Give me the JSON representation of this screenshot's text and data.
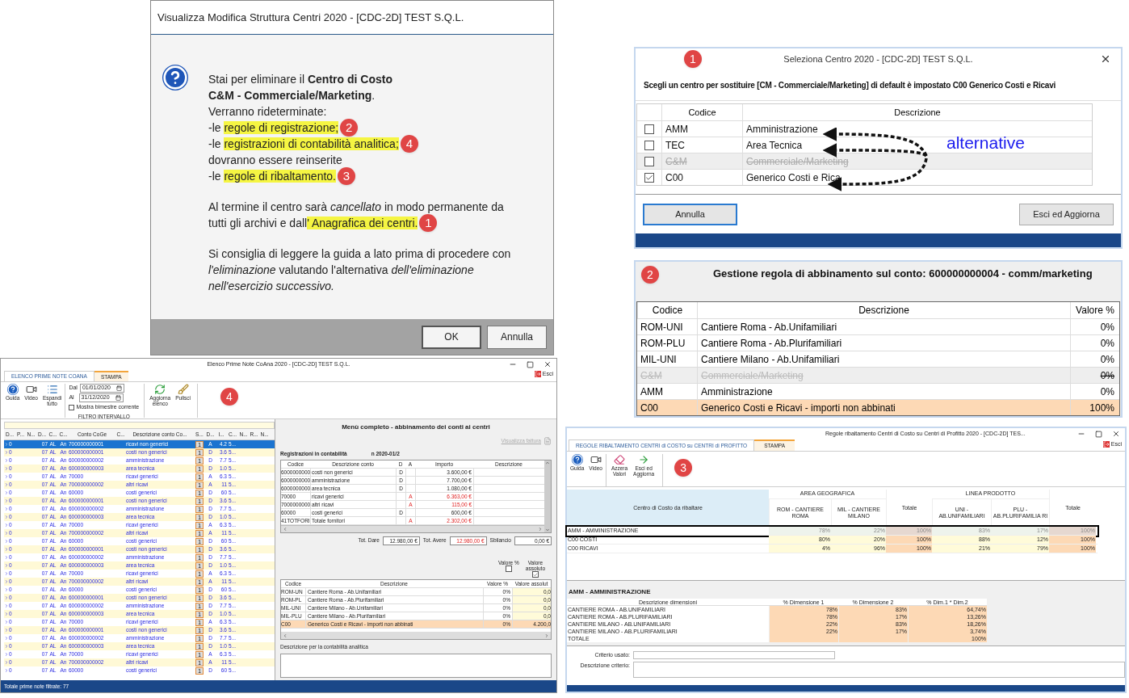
{
  "dialog": {
    "title": "Visualizza Modifica Struttura Centri 2020 - [CDC-2D] TEST S.Q.L.",
    "paragraphs": [
      [
        {
          "text": "Stai per eliminare il **Centro di Costo**"
        },
        {
          "text": "**C&M - Commerciale/Marketing**."
        },
        {
          "text": "Verranno rideterminate:"
        },
        {
          "text": "-le ",
          "highlight": "regole di registrazione;",
          "badge": "2"
        },
        {
          "text": "-le ",
          "highlight": "registrazioni di contabilità analitica;",
          "badge": "4"
        },
        {
          "text": "dovranno essere reinserite"
        },
        {
          "text": "-le ",
          "highlight": "regole di ribaltamento.",
          "badge": "3"
        }
      ],
      [
        {
          "text": "Al termine il centro sarà *cancellato* in modo permanente da"
        },
        {
          "text": "tutti gli archivi e dall",
          "highlight": "' Anagrafica dei centri.",
          "badge": "1"
        }
      ]
    ],
    "advice": "Si consiglia di leggere la guida a lato prima di procedere con\n*l'eliminazione* valutando l'alternativa *dell'eliminazione*\n*nell'esercizio successivo.*",
    "buttons": [
      {
        "label": "OK",
        "default": true
      },
      {
        "label": "Annulla",
        "default": false
      }
    ]
  },
  "select_window": {
    "badge": "1",
    "title": "Seleziona Centro 2020 - [CDC-2D] TEST S.Q.L.",
    "instruction": "Scegli un centro per sostituire [CM - Commerciale/Marketing] di default è impostato C00 Generico Costi e Ricavi",
    "columns": [
      "Codice",
      "Descrizione"
    ],
    "rows": [
      {
        "code": "AMM",
        "description": "Amministrazione",
        "checked": false,
        "disabled": false
      },
      {
        "code": "TEC",
        "description": "Area Tecnica",
        "checked": false,
        "disabled": false
      },
      {
        "code": "C&M",
        "description": "Commerciale/Marketing",
        "checked": false,
        "disabled": true
      },
      {
        "code": "C00",
        "description": "Generico Costi e Rica",
        "checked": true,
        "disabled": false
      }
    ],
    "annotation": "alternative",
    "buttons": [
      {
        "label": "Annulla",
        "focused": true
      },
      {
        "label": "Esci ed Aggiorna",
        "focused": false
      }
    ]
  },
  "rule_window": {
    "badge": "2",
    "title": "Gestione regola di abbinamento sul conto: 600000000004 - comm/marketing",
    "columns": [
      "Codice",
      "Descrizione",
      "Valore %"
    ],
    "rows": [
      {
        "code": "ROM-UNI",
        "description": "Cantiere Roma - Ab.Unifamiliari",
        "value": "0%",
        "disabled": false,
        "highlighted": false
      },
      {
        "code": "ROM-PLU",
        "description": "Cantiere Roma - Ab.Plurifamiliari",
        "value": "0%",
        "disabled": false,
        "highlighted": false
      },
      {
        "code": "MIL-UNI",
        "description": "Cantiere Milano - Ab.Unifamiliari",
        "value": "0%",
        "disabled": false,
        "highlighted": false
      },
      {
        "code": "C&M",
        "description": "Commerciale/Marketing",
        "value": "0%",
        "disabled": true,
        "highlighted": false
      },
      {
        "code": "AMM",
        "description": "Amministrazione",
        "value": "0%",
        "disabled": false,
        "highlighted": false
      },
      {
        "code": "C00",
        "description": "Generico Costi e Ricavi - importi non abbinati",
        "value": "100%",
        "disabled": false,
        "highlighted": true
      }
    ]
  },
  "journal_window": {
    "title": "Elenco Prime Note CoAna 2020 - [CDC-2D] TEST S.Q.L.",
    "exit": "Esci",
    "badge": "4",
    "tabs": [
      {
        "label": "ELENCO PRIME NOTE COANA",
        "selected": true
      },
      {
        "label": "STAMPA",
        "selected": false
      }
    ],
    "tools": [
      {
        "kind": "help",
        "label": "Guida"
      },
      {
        "kind": "video",
        "label": "Video"
      },
      {
        "kind": "expand",
        "label": "Espandi\ntutto"
      }
    ],
    "filter": {
      "from_label": "Dal",
      "from": "01/01/2020",
      "to_label": "Al",
      "to": "31/12/2020",
      "checkbox": {
        "label": "Mostra bimestre corrente",
        "checked": false
      },
      "group": "FILTRO INTERVALLO"
    },
    "tools_2": [
      {
        "kind": "refresh",
        "label": "Aggiorna\nelenco"
      },
      {
        "kind": "broom",
        "label": "Pulisci"
      }
    ],
    "grid_columns": [
      "D...",
      "P...",
      "N...",
      "D...",
      "C...",
      "C...",
      "Conto CoGe",
      "C...",
      "Descrizione conto Co...",
      "S...",
      "D...",
      "I...",
      "C...",
      "N...",
      "R...",
      "N..."
    ],
    "grid_rows": [
      {
        "selected": true,
        "cells": [
          "0",
          "07",
          "AL",
          "An",
          "700000000001",
          "ricavi non generici",
          "1",
          "A",
          "4.2",
          "5..."
        ]
      },
      {
        "selected": false,
        "cells": [
          "0",
          "07",
          "AL",
          "An",
          "600000000001",
          "costi non generici",
          "1",
          "D",
          "3.6",
          "5..."
        ]
      },
      {
        "selected": false,
        "cells": [
          "0",
          "07",
          "AL",
          "An",
          "600000000002",
          "amministrazione",
          "1",
          "D",
          "7.7",
          "5..."
        ]
      },
      {
        "selected": false,
        "cells": [
          "0",
          "07",
          "AL",
          "An",
          "600000000003",
          "area tecnica",
          "1",
          "D",
          "1.0",
          "5..."
        ]
      },
      {
        "selected": false,
        "cells": [
          "0",
          "07",
          "AL",
          "An",
          "70000",
          "ricavi generici",
          "1",
          "A",
          "6.3",
          "5..."
        ]
      },
      {
        "selected": false,
        "cells": [
          "0",
          "07",
          "AL",
          "An",
          "700000000002",
          "altri ricavi",
          "1",
          "A",
          "11",
          "5..."
        ]
      },
      {
        "selected": false,
        "cells": [
          "0",
          "07",
          "AL",
          "An",
          "60000",
          "costi generici",
          "1",
          "D",
          "60",
          "5..."
        ]
      },
      {
        "selected": false,
        "cells": [
          "0",
          "07",
          "AL",
          "An",
          "600000000001",
          "costi non generici",
          "1",
          "D",
          "3.6",
          "5..."
        ]
      },
      {
        "selected": false,
        "cells": [
          "0",
          "07",
          "AL",
          "An",
          "600000000002",
          "amministrazione",
          "1",
          "D",
          "7.7",
          "5..."
        ]
      },
      {
        "selected": false,
        "cells": [
          "0",
          "07",
          "AL",
          "An",
          "600000000003",
          "area tecnica",
          "1",
          "D",
          "1.0",
          "5..."
        ]
      },
      {
        "selected": false,
        "cells": [
          "0",
          "07",
          "AL",
          "An",
          "70000",
          "ricavi generici",
          "1",
          "A",
          "6.3",
          "5..."
        ]
      },
      {
        "selected": false,
        "cells": [
          "0",
          "07",
          "AL",
          "An",
          "700000000002",
          "altri ricavi",
          "1",
          "A",
          "11",
          "5..."
        ]
      },
      {
        "selected": false,
        "cells": [
          "0",
          "07",
          "AL",
          "An",
          "60000",
          "costi generici",
          "1",
          "D",
          "60",
          "5..."
        ]
      },
      {
        "selected": false,
        "cells": [
          "0",
          "07",
          "AL",
          "An",
          "600000000001",
          "costi non generici",
          "1",
          "D",
          "3.6",
          "5..."
        ]
      },
      {
        "selected": false,
        "cells": [
          "0",
          "07",
          "AL",
          "An",
          "600000000002",
          "amministrazione",
          "1",
          "D",
          "7.7",
          "5..."
        ]
      },
      {
        "selected": false,
        "cells": [
          "0",
          "07",
          "AL",
          "An",
          "600000000003",
          "area tecnica",
          "1",
          "D",
          "1.0",
          "5..."
        ]
      },
      {
        "selected": false,
        "cells": [
          "0",
          "07",
          "AL",
          "An",
          "70000",
          "ricavi generici",
          "1",
          "A",
          "6.3",
          "5..."
        ]
      },
      {
        "selected": false,
        "cells": [
          "0",
          "07",
          "AL",
          "An",
          "700000000002",
          "altri ricavi",
          "1",
          "A",
          "11",
          "5..."
        ]
      },
      {
        "selected": false,
        "cells": [
          "0",
          "07",
          "AL",
          "An",
          "60000",
          "costi generici",
          "1",
          "D",
          "60",
          "5..."
        ]
      },
      {
        "selected": false,
        "cells": [
          "0",
          "07",
          "AL",
          "An",
          "600000000001",
          "costi non generici",
          "1",
          "D",
          "3.6",
          "5..."
        ]
      },
      {
        "selected": false,
        "cells": [
          "0",
          "07",
          "AL",
          "An",
          "600000000002",
          "amministrazione",
          "1",
          "D",
          "7.7",
          "5..."
        ]
      },
      {
        "selected": false,
        "cells": [
          "0",
          "07",
          "AL",
          "An",
          "600000000003",
          "area tecnica",
          "1",
          "D",
          "1.0",
          "5..."
        ]
      },
      {
        "selected": false,
        "cells": [
          "0",
          "07",
          "AL",
          "An",
          "70000",
          "ricavi generici",
          "1",
          "A",
          "6.3",
          "5..."
        ]
      },
      {
        "selected": false,
        "cells": [
          "0",
          "07",
          "AL",
          "An",
          "600000000001",
          "costi non generici",
          "1",
          "D",
          "3.6",
          "5..."
        ]
      },
      {
        "selected": false,
        "cells": [
          "0",
          "07",
          "AL",
          "An",
          "600000000002",
          "amministrazione",
          "1",
          "D",
          "7.7",
          "5..."
        ]
      },
      {
        "selected": false,
        "cells": [
          "0",
          "07",
          "AL",
          "An",
          "600000000003",
          "area tecnica",
          "1",
          "D",
          "1.0",
          "5..."
        ]
      },
      {
        "selected": false,
        "cells": [
          "0",
          "07",
          "AL",
          "An",
          "70000",
          "ricavi generici",
          "1",
          "A",
          "6.3",
          "5..."
        ]
      },
      {
        "selected": false,
        "cells": [
          "0",
          "07",
          "AL",
          "An",
          "700000000002",
          "altri ricavi",
          "1",
          "A",
          "11",
          "5..."
        ]
      },
      {
        "selected": false,
        "cells": [
          "0",
          "07",
          "AL",
          "An",
          "60000",
          "costi generici",
          "1",
          "D",
          "60",
          "5..."
        ]
      }
    ],
    "status": "Totale prime note filtrate: 77",
    "detail": {
      "title": "Menù completo - abbinamento dei conti ai centri",
      "invoice_link": "Visualizza fattura",
      "section": "Registrazioni in contabilità",
      "reference": "n 2020-01/2",
      "columns": [
        "Codice",
        "Descrizione conto",
        "D",
        "A",
        "Importo",
        "Descrizione"
      ],
      "rows": [
        {
          "code": "6000000000",
          "description": "costi non generici",
          "side": "D",
          "credit": false,
          "amount": "3.600,00 €"
        },
        {
          "code": "6000000000",
          "description": "amministrazione",
          "side": "D",
          "credit": false,
          "amount": "7.700,00 €"
        },
        {
          "code": "6000000000",
          "description": "area tecnica",
          "side": "D",
          "credit": false,
          "amount": "1.080,00 €"
        },
        {
          "code": "70000",
          "description": "ricavi generici",
          "side": "A",
          "credit": true,
          "amount": "6.363,00 €"
        },
        {
          "code": "7000000000",
          "description": "altri ricavi",
          "side": "A",
          "credit": true,
          "amount": "115,00 €"
        },
        {
          "code": "60000",
          "description": "costi generici",
          "side": "D",
          "credit": false,
          "amount": "600,00 €"
        },
        {
          "code": "41TOTFORI",
          "description": "Totale fornitori",
          "side": "A",
          "credit": true,
          "amount": "2.302,00 €"
        }
      ],
      "totals": [
        {
          "label": "Tot. Dare",
          "value": "12.980,00 €",
          "credit": false
        },
        {
          "label": "Tot. Avere",
          "value": "12.980,00 €",
          "credit": true
        },
        {
          "label": "Sbilancio",
          "value": "0,00 €",
          "credit": false
        }
      ],
      "options": [
        {
          "label": "Valore %",
          "checked": false
        },
        {
          "label": "Valore\nassoluto",
          "checked": true
        }
      ],
      "centers_columns": [
        "Codice",
        "Descrizione",
        "Valore %",
        "Valore assolut"
      ],
      "centers": [
        {
          "code": "ROM-UN",
          "description": "Cantiere Roma - Ab.Unifamiliari",
          "percent": "0%",
          "absolute": "0,0",
          "highlighted": false
        },
        {
          "code": "ROM-PL",
          "description": "Cantiere Roma - Ab.Plurifamiliari",
          "percent": "0%",
          "absolute": "0,0",
          "highlighted": false
        },
        {
          "code": "MIL-UNI",
          "description": "Cantiere Milano - Ab.Unifamiliari",
          "percent": "0%",
          "absolute": "0,0",
          "highlighted": false
        },
        {
          "code": "MIL-PLU",
          "description": "Cantiere Milano - Ab.Plurifamiliari",
          "percent": "0%",
          "absolute": "0,0",
          "highlighted": false
        },
        {
          "code": "C00",
          "description": "Generico Costi e Ricavi - importi non abbinati",
          "percent": "0%",
          "absolute": "4.200,0",
          "highlighted": true
        }
      ],
      "notes_label": "Descrizione per la contabilità analitica"
    }
  },
  "allocation_window": {
    "title": "Regole ribaltamento Centri di Costo su Centri di Profitto 2020 - [CDC-2D] TES...",
    "exit": "Esci",
    "badge": "3",
    "tabs": [
      {
        "label": "REGOLE RIBALTAMENTO CENTRI di COSTO su CENTRI di PROFITTO",
        "selected": true
      },
      {
        "label": "STAMPA",
        "selected": false
      }
    ],
    "tools": [
      {
        "kind": "help",
        "label": "Guida"
      },
      {
        "kind": "video",
        "label": "Video"
      },
      {
        "kind": "eraser",
        "label": "Azzera\nValori"
      },
      {
        "kind": "arrow",
        "label": "Esci ed\nAggiorna"
      }
    ],
    "first_header": "Centro di Costo da ribaltare",
    "groups": [
      {
        "label": "AREA GEOGRAFICA",
        "columns": [
          "ROM - CANTIERE ROMA",
          "MIL - CANTIERE MILANO"
        ],
        "total": "Totale"
      },
      {
        "label": "LINEA PRODOTTO",
        "columns": [
          "UNI - AB.UNIFAMILIARI",
          "PLU - AB.PLURIFAMILIA RI"
        ],
        "total": "Totale"
      }
    ],
    "rows": [
      {
        "label": "AMM - AMMINISTRAZIONE",
        "selected": true,
        "values": [
          "78%",
          "22%",
          "100%",
          "83%",
          "17%",
          "100%"
        ]
      },
      {
        "label": "C00 COSTI",
        "selected": false,
        "values": [
          "80%",
          "20%",
          "100%",
          "88%",
          "12%",
          "100%"
        ]
      },
      {
        "label": "C00 RICAVI",
        "selected": false,
        "values": [
          "4%",
          "96%",
          "100%",
          "21%",
          "79%",
          "100%"
        ]
      }
    ],
    "detail_title": "AMM - AMMINISTRAZIONE",
    "detail_columns": [
      "Descrizione dimensioni",
      "% Dimensione 1",
      "% Dimensione 2",
      "% Dim.1 * Dim.2"
    ],
    "detail_rows": [
      {
        "label": "CANTIERE ROMA - AB.UNIFAMILIARI",
        "values": [
          "78%",
          "83%",
          "64,74%"
        ]
      },
      {
        "label": "CANTIERE ROMA - AB.PLURIFAMILIARI",
        "values": [
          "78%",
          "17%",
          "13,26%"
        ]
      },
      {
        "label": "CANTIERE MILANO - AB.UNIFAMILIARI",
        "values": [
          "22%",
          "83%",
          "18,26%"
        ]
      },
      {
        "label": "CANTIERE MILANO - AB.PLURIFAMILIARI",
        "values": [
          "22%",
          "17%",
          "3,74%"
        ]
      },
      {
        "label": "TOTALE",
        "values": [
          "100%"
        ]
      }
    ],
    "criteria_label": "Criterio usato:",
    "criteria_description_label": "Descrizione criterio:"
  }
}
